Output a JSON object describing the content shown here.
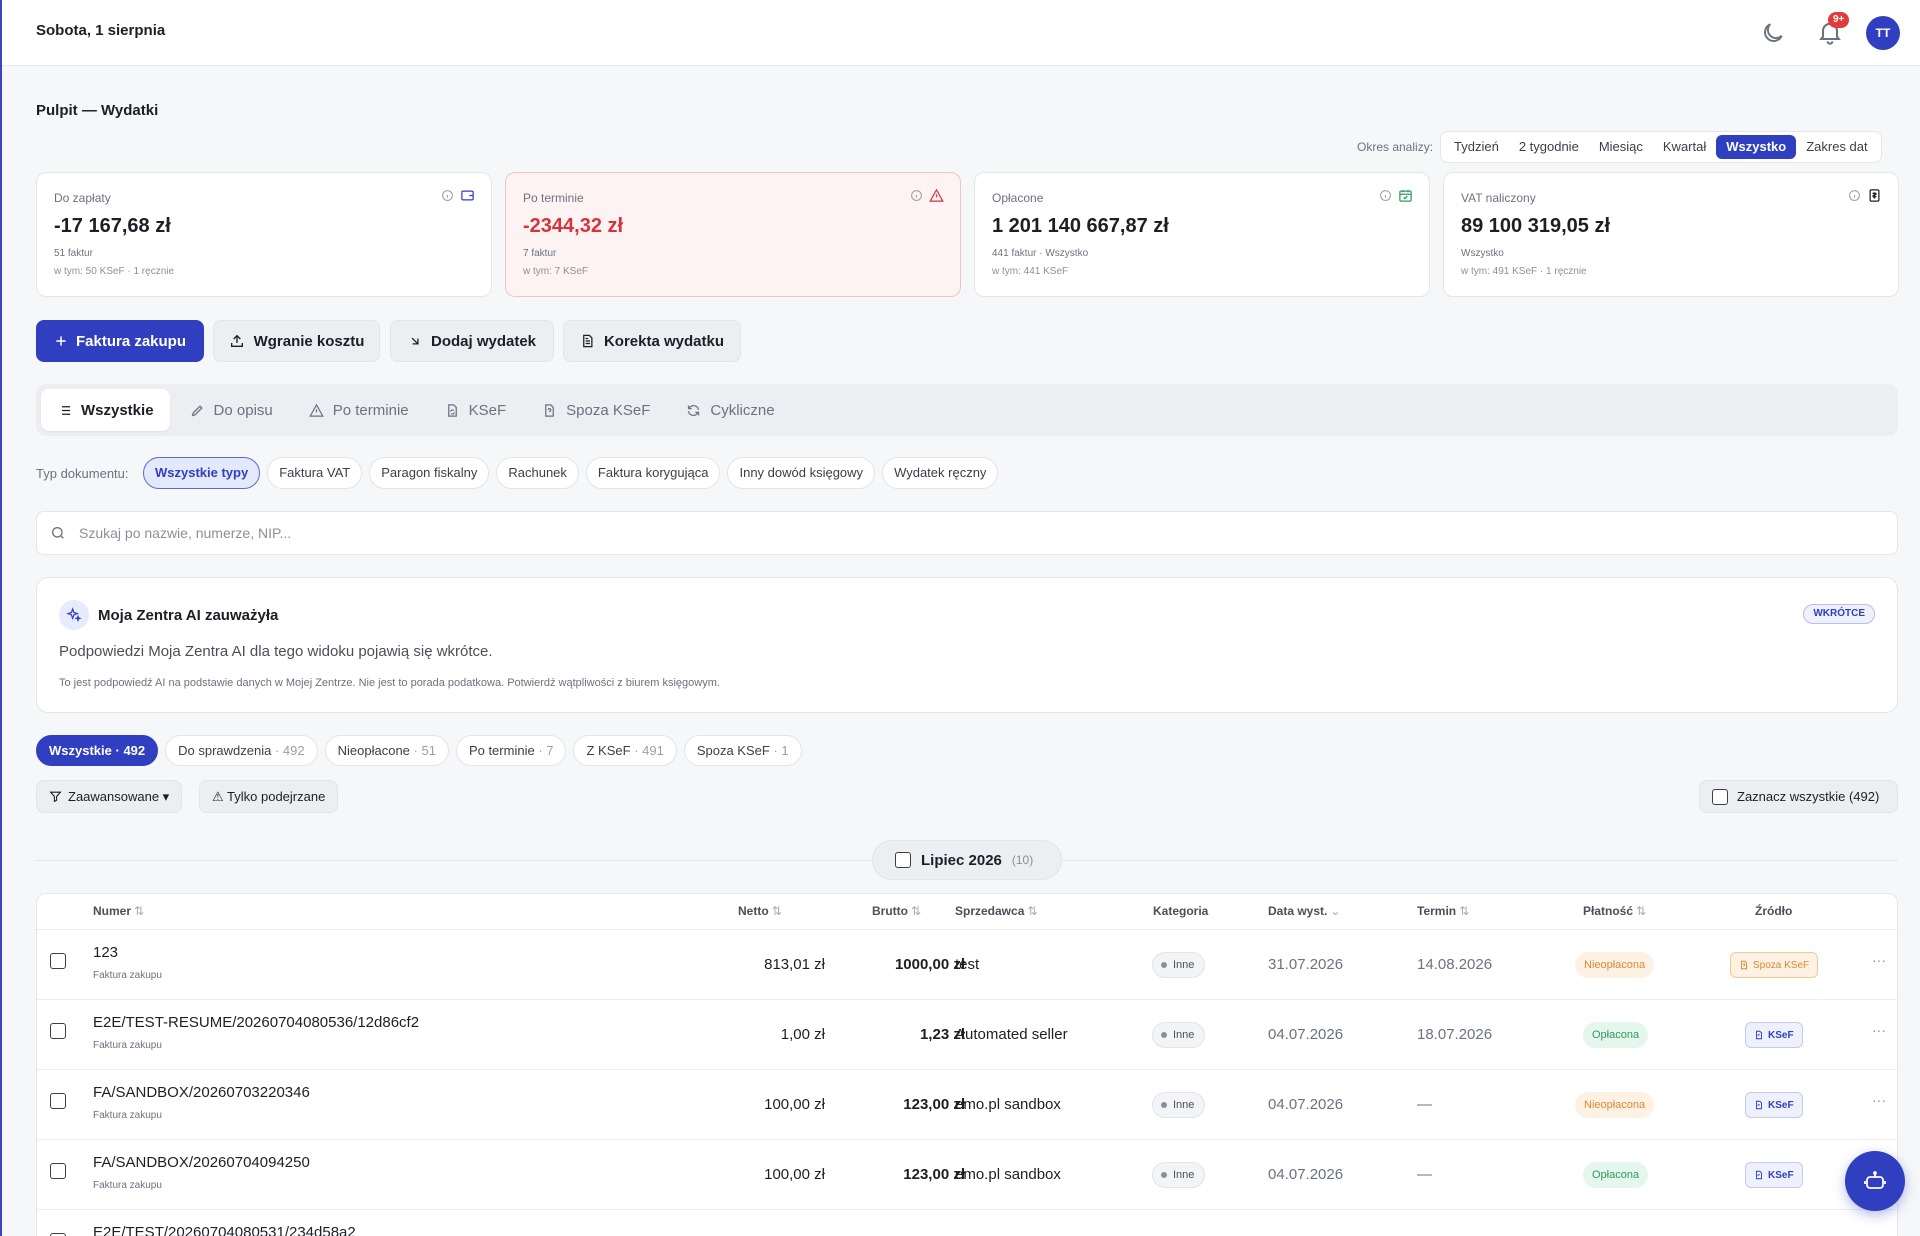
{
  "header": {
    "date": "Sobota, 1 sierpnia",
    "notifications": "9+",
    "avatar": "TT"
  },
  "page_title": "Pulpit — Wydatki",
  "period": {
    "label": "Okres analizy:",
    "options": [
      "Tydzień",
      "2 tygodnie",
      "Miesiąc",
      "Kwartał",
      "Wszystko",
      "Zakres dat"
    ],
    "selected": "Wszystko"
  },
  "cards": [
    {
      "label": "Do zapłaty",
      "value": "-17 167,68 zł",
      "sub1": "51 faktur",
      "sub2": "w tym: 50 KSeF · 1 ręcznie",
      "icon": "wallet-icon"
    },
    {
      "label": "Po terminie",
      "value": "-2344,32 zł",
      "sub1": "7 faktur",
      "sub2": "w tym: 7 KSeF",
      "icon": "warning-icon"
    },
    {
      "label": "Opłacone",
      "value": "1 201 140 667,87 zł",
      "sub1": "441 faktur · Wszystko",
      "sub2": "w tym: 441 KSeF",
      "icon": "calendar-check-icon"
    },
    {
      "label": "VAT naliczony",
      "value": "89 100 319,05 zł",
      "sub1": "Wszystko",
      "sub2": "w tym: 491 KSeF · 1 ręcznie",
      "icon": "tax-document-icon"
    }
  ],
  "actions": {
    "primary": "Faktura zakupu",
    "upload": "Wgranie kosztu",
    "add": "Dodaj wydatek",
    "correction": "Korekta wydatku"
  },
  "tabs": [
    "Wszystkie",
    "Do opisu",
    "Po terminie",
    "KSeF",
    "Spoza KSeF",
    "Cykliczne"
  ],
  "doc_types": {
    "label": "Typ dokumentu:",
    "items": [
      "Wszystkie typy",
      "Faktura VAT",
      "Paragon fiskalny",
      "Rachunek",
      "Faktura korygująca",
      "Inny dowód księgowy",
      "Wydatek ręczny"
    ]
  },
  "search": {
    "placeholder": "Szukaj po nazwie, numerze, NIP..."
  },
  "ai": {
    "title": "Moja Zentra AI zauważyła",
    "badge": "WKRÓTCE",
    "text": "Podpowiedzi Moja Zentra AI dla tego widoku pojawią się wkrótce.",
    "note": "To jest podpowiedź AI na podstawie danych w Mojej Zentrze. Nie jest to porada podatkowa. Potwierdź wątpliwości z biurem księgowym."
  },
  "status_filters": [
    {
      "label": "Wszystkie",
      "count": "· 492"
    },
    {
      "label": "Do sprawdzenia",
      "count": "· 492"
    },
    {
      "label": "Nieopłacone",
      "count": "· 51"
    },
    {
      "label": "Po terminie",
      "count": "· 7"
    },
    {
      "label": "Z KSeF",
      "count": "· 491"
    },
    {
      "label": "Spoza KSeF",
      "count": "· 1"
    }
  ],
  "filters": {
    "advanced": "Zaawansowane ▾",
    "suspicious": "⚠ Tylko podejrzane",
    "select_all": "Zaznacz wszystkie (492)"
  },
  "month_group": {
    "label": "Lipiec 2026",
    "count": "(10)"
  },
  "table": {
    "columns": [
      "Numer",
      "Netto",
      "Brutto",
      "Sprzedawca",
      "Kategoria",
      "Data wyst.",
      "Termin",
      "Płatność",
      "Źródło"
    ],
    "rows": [
      {
        "number": "123",
        "type": "Faktura zakupu",
        "netto": "813,01 zł",
        "brutto": "1000,00 zł",
        "seller": "test",
        "category": "Inne",
        "issued": "31.07.2026",
        "due": "14.08.2026",
        "payment": "Nieopłacona",
        "source": "Spoza KSeF"
      },
      {
        "number": "E2E/TEST-RESUME/20260704080536/12d86cf2",
        "type": "Faktura zakupu",
        "netto": "1,00 zł",
        "brutto": "1,23 zł",
        "seller": "Automated seller",
        "category": "Inne",
        "issued": "04.07.2026",
        "due": "18.07.2026",
        "payment": "Opłacona",
        "source": "KSeF"
      },
      {
        "number": "FA/SANDBOX/20260703220346",
        "type": "Faktura zakupu",
        "netto": "100,00 zł",
        "brutto": "123,00 zł",
        "seller": "emo.pl sandbox",
        "category": "Inne",
        "issued": "04.07.2026",
        "due": "—",
        "payment": "Nieopłacona",
        "source": "KSeF"
      },
      {
        "number": "FA/SANDBOX/20260704094250",
        "type": "Faktura zakupu",
        "netto": "100,00 zł",
        "brutto": "123,00 zł",
        "seller": "emo.pl sandbox",
        "category": "Inne",
        "issued": "04.07.2026",
        "due": "—",
        "payment": "Opłacona",
        "source": "KSeF"
      },
      {
        "number": "E2E/TEST/20260704080531/234d58a2",
        "type": "",
        "netto": "",
        "brutto": "",
        "seller": "",
        "category": "",
        "issued": "",
        "due": "",
        "payment": "",
        "source": ""
      }
    ]
  },
  "more_label": "···"
}
